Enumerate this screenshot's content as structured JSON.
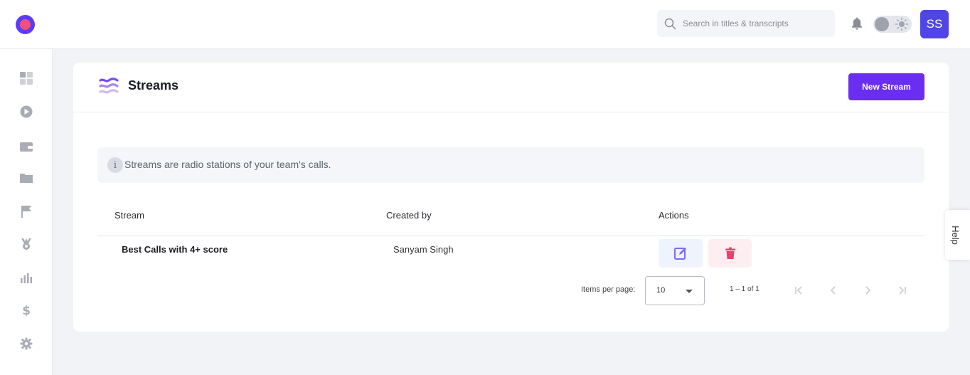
{
  "header": {
    "search_placeholder": "Search in titles & transcripts",
    "avatar_initials": "SS"
  },
  "sidebar": {
    "items": [
      "dashboard-icon",
      "play-icon",
      "wallet-icon",
      "folder-icon",
      "flag-icon",
      "medal-icon",
      "bar-chart-icon",
      "dollar-icon",
      "gear-icon"
    ]
  },
  "page": {
    "title": "Streams",
    "new_button_label": "New Stream",
    "info_text": "Streams are radio stations of your team's calls.",
    "info_icon": "i"
  },
  "table": {
    "columns": [
      "Stream",
      "Created by",
      "Actions"
    ],
    "rows": [
      {
        "stream": "Best Calls with 4+ score",
        "created_by": "Sanyam Singh"
      }
    ]
  },
  "pagination": {
    "items_per_page_label": "Items per page:",
    "items_per_page_value": "10",
    "range_label": "1 – 1 of 1"
  },
  "help_label": "Help",
  "colors": {
    "accent": "#6a2ef0",
    "avatar": "#5046e5",
    "delete": "#ef3f6b"
  }
}
